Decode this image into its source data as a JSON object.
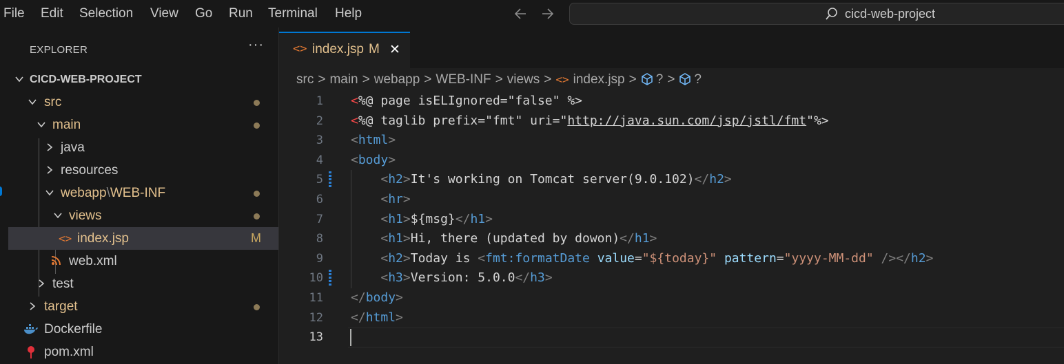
{
  "menu": [
    "File",
    "Edit",
    "Selection",
    "View",
    "Go",
    "Run",
    "Terminal",
    "Help"
  ],
  "nav": {
    "back_icon": "arrow-left-icon",
    "forward_icon": "arrow-right-icon"
  },
  "search": {
    "text": "cicd-web-project",
    "icon": "search-icon"
  },
  "explorer": {
    "title": "EXPLORER",
    "more": "···",
    "tree": [
      {
        "label": "CICD-WEB-PROJECT",
        "kind": "folder-open"
      },
      {
        "label": "src",
        "kind": "folder-open",
        "modified": true
      },
      {
        "label": "main",
        "kind": "folder-open",
        "modified": true
      },
      {
        "label": "java",
        "kind": "folder-closed"
      },
      {
        "label": "resources",
        "kind": "folder-closed"
      },
      {
        "label": "webapp",
        "label2": "WEB-INF",
        "sep": "\\",
        "kind": "folder-open",
        "modified": true
      },
      {
        "label": "views",
        "kind": "folder-open",
        "modified": true
      },
      {
        "label": "index.jsp",
        "kind": "file",
        "badge": "M",
        "icon": "jsp-file-icon"
      },
      {
        "label": "web.xml",
        "kind": "file",
        "icon": "xml-rss-icon"
      },
      {
        "label": "test",
        "kind": "folder-closed"
      },
      {
        "label": "target",
        "kind": "folder-closed",
        "modified": true
      },
      {
        "label": "Dockerfile",
        "kind": "file",
        "icon": "docker-icon"
      },
      {
        "label": "pom.xml",
        "kind": "file",
        "icon": "maven-pin-icon"
      }
    ]
  },
  "tab": {
    "icon": "<>",
    "name": "index.jsp",
    "badge": "M",
    "close": "✕"
  },
  "breadcrumb": {
    "parts": [
      "src",
      "main",
      "webapp",
      "WEB-INF",
      "views"
    ],
    "file_icon": "<>",
    "file": "index.jsp",
    "symbols": [
      "?",
      "?"
    ],
    "sep": ">"
  },
  "editor": {
    "line_numbers": [
      "1",
      "2",
      "3",
      "4",
      "5",
      "6",
      "7",
      "8",
      "9",
      "10",
      "11",
      "12",
      "13"
    ],
    "active_line": "13",
    "lines": [
      "<%@ page isELIgnored=\"false\" %>",
      "<%@ taglib prefix=\"fmt\" uri=\"http://java.sun.com/jsp/jstl/fmt\"%>",
      "<html>",
      "<body>",
      "    <h2>It's working on Tomcat server(9.0.102)</h2>",
      "    <hr>",
      "    <h1>${msg}</h1>",
      "    <h1>Hi, there (updated by dowon)</h1>",
      "    <h2>Today is <fmt:formatDate value=\"${today}\" pattern=\"yyyy-MM-dd\" /></h2>",
      "    <h3>Version: 5.0.0</h3>",
      "</body>",
      "</html>",
      ""
    ],
    "modified_lines": [
      "5",
      "10"
    ]
  }
}
